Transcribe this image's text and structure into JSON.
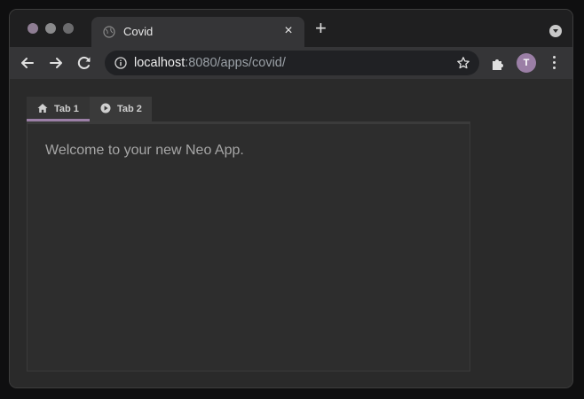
{
  "window": {
    "traffic_lights": [
      "#8e7d93",
      "#8a8a8c",
      "#6b6b6d"
    ]
  },
  "browser_tab": {
    "title": "Covid",
    "close_label": "×"
  },
  "tabstrip": {
    "new_tab_label": "+"
  },
  "omnibox": {
    "url_host": "localhost",
    "url_rest": ":8080/apps/covid/"
  },
  "profile": {
    "initial": "T",
    "color": "#9b7fa6"
  },
  "app": {
    "tabs": [
      {
        "label": "Tab 1",
        "icon": "home-icon",
        "active": true
      },
      {
        "label": "Tab 2",
        "icon": "play-circle-icon",
        "active": false
      }
    ],
    "welcome_text": "Welcome to your new Neo App."
  },
  "colors": {
    "accent": "#9b7fa6",
    "background": "#2a2a2a"
  }
}
